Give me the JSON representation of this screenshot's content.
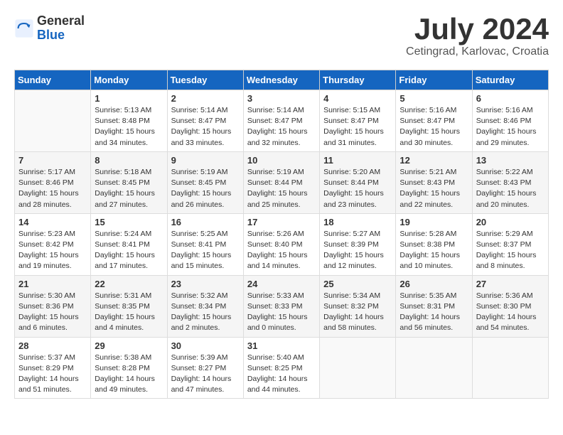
{
  "logo": {
    "general": "General",
    "blue": "Blue"
  },
  "title": "July 2024",
  "location": "Cetingrad, Karlovac, Croatia",
  "days_of_week": [
    "Sunday",
    "Monday",
    "Tuesday",
    "Wednesday",
    "Thursday",
    "Friday",
    "Saturday"
  ],
  "weeks": [
    [
      {
        "day": "",
        "info": ""
      },
      {
        "day": "1",
        "info": "Sunrise: 5:13 AM\nSunset: 8:48 PM\nDaylight: 15 hours\nand 34 minutes."
      },
      {
        "day": "2",
        "info": "Sunrise: 5:14 AM\nSunset: 8:47 PM\nDaylight: 15 hours\nand 33 minutes."
      },
      {
        "day": "3",
        "info": "Sunrise: 5:14 AM\nSunset: 8:47 PM\nDaylight: 15 hours\nand 32 minutes."
      },
      {
        "day": "4",
        "info": "Sunrise: 5:15 AM\nSunset: 8:47 PM\nDaylight: 15 hours\nand 31 minutes."
      },
      {
        "day": "5",
        "info": "Sunrise: 5:16 AM\nSunset: 8:47 PM\nDaylight: 15 hours\nand 30 minutes."
      },
      {
        "day": "6",
        "info": "Sunrise: 5:16 AM\nSunset: 8:46 PM\nDaylight: 15 hours\nand 29 minutes."
      }
    ],
    [
      {
        "day": "7",
        "info": "Sunrise: 5:17 AM\nSunset: 8:46 PM\nDaylight: 15 hours\nand 28 minutes."
      },
      {
        "day": "8",
        "info": "Sunrise: 5:18 AM\nSunset: 8:45 PM\nDaylight: 15 hours\nand 27 minutes."
      },
      {
        "day": "9",
        "info": "Sunrise: 5:19 AM\nSunset: 8:45 PM\nDaylight: 15 hours\nand 26 minutes."
      },
      {
        "day": "10",
        "info": "Sunrise: 5:19 AM\nSunset: 8:44 PM\nDaylight: 15 hours\nand 25 minutes."
      },
      {
        "day": "11",
        "info": "Sunrise: 5:20 AM\nSunset: 8:44 PM\nDaylight: 15 hours\nand 23 minutes."
      },
      {
        "day": "12",
        "info": "Sunrise: 5:21 AM\nSunset: 8:43 PM\nDaylight: 15 hours\nand 22 minutes."
      },
      {
        "day": "13",
        "info": "Sunrise: 5:22 AM\nSunset: 8:43 PM\nDaylight: 15 hours\nand 20 minutes."
      }
    ],
    [
      {
        "day": "14",
        "info": "Sunrise: 5:23 AM\nSunset: 8:42 PM\nDaylight: 15 hours\nand 19 minutes."
      },
      {
        "day": "15",
        "info": "Sunrise: 5:24 AM\nSunset: 8:41 PM\nDaylight: 15 hours\nand 17 minutes."
      },
      {
        "day": "16",
        "info": "Sunrise: 5:25 AM\nSunset: 8:41 PM\nDaylight: 15 hours\nand 15 minutes."
      },
      {
        "day": "17",
        "info": "Sunrise: 5:26 AM\nSunset: 8:40 PM\nDaylight: 15 hours\nand 14 minutes."
      },
      {
        "day": "18",
        "info": "Sunrise: 5:27 AM\nSunset: 8:39 PM\nDaylight: 15 hours\nand 12 minutes."
      },
      {
        "day": "19",
        "info": "Sunrise: 5:28 AM\nSunset: 8:38 PM\nDaylight: 15 hours\nand 10 minutes."
      },
      {
        "day": "20",
        "info": "Sunrise: 5:29 AM\nSunset: 8:37 PM\nDaylight: 15 hours\nand 8 minutes."
      }
    ],
    [
      {
        "day": "21",
        "info": "Sunrise: 5:30 AM\nSunset: 8:36 PM\nDaylight: 15 hours\nand 6 minutes."
      },
      {
        "day": "22",
        "info": "Sunrise: 5:31 AM\nSunset: 8:35 PM\nDaylight: 15 hours\nand 4 minutes."
      },
      {
        "day": "23",
        "info": "Sunrise: 5:32 AM\nSunset: 8:34 PM\nDaylight: 15 hours\nand 2 minutes."
      },
      {
        "day": "24",
        "info": "Sunrise: 5:33 AM\nSunset: 8:33 PM\nDaylight: 15 hours\nand 0 minutes."
      },
      {
        "day": "25",
        "info": "Sunrise: 5:34 AM\nSunset: 8:32 PM\nDaylight: 14 hours\nand 58 minutes."
      },
      {
        "day": "26",
        "info": "Sunrise: 5:35 AM\nSunset: 8:31 PM\nDaylight: 14 hours\nand 56 minutes."
      },
      {
        "day": "27",
        "info": "Sunrise: 5:36 AM\nSunset: 8:30 PM\nDaylight: 14 hours\nand 54 minutes."
      }
    ],
    [
      {
        "day": "28",
        "info": "Sunrise: 5:37 AM\nSunset: 8:29 PM\nDaylight: 14 hours\nand 51 minutes."
      },
      {
        "day": "29",
        "info": "Sunrise: 5:38 AM\nSunset: 8:28 PM\nDaylight: 14 hours\nand 49 minutes."
      },
      {
        "day": "30",
        "info": "Sunrise: 5:39 AM\nSunset: 8:27 PM\nDaylight: 14 hours\nand 47 minutes."
      },
      {
        "day": "31",
        "info": "Sunrise: 5:40 AM\nSunset: 8:25 PM\nDaylight: 14 hours\nand 44 minutes."
      },
      {
        "day": "",
        "info": ""
      },
      {
        "day": "",
        "info": ""
      },
      {
        "day": "",
        "info": ""
      }
    ]
  ]
}
